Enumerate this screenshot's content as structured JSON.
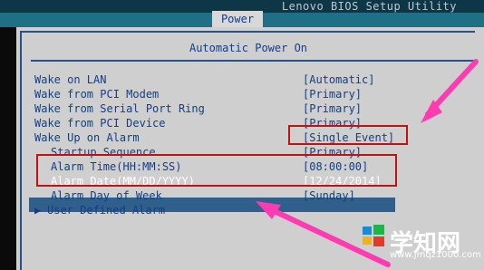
{
  "app": {
    "vendor_title": "Lenovo BIOS Setup Utility"
  },
  "tabs": {
    "active": "Power"
  },
  "section": {
    "title": "Automatic Power On"
  },
  "settings": [
    {
      "label": "Wake on LAN",
      "value": "[Automatic]"
    },
    {
      "label": "Wake from PCI Modem",
      "value": "[Primary]"
    },
    {
      "label": "Wake from Serial Port Ring",
      "value": "[Primary]"
    },
    {
      "label": "Wake from PCI Device",
      "value": "[Primary]"
    },
    {
      "label": "Wake Up on Alarm",
      "value": "[Single Event]"
    },
    {
      "label": "Startup Sequence",
      "value": "[Primary]"
    },
    {
      "label": "Alarm Time(HH:MM:SS)",
      "value": "[08:00:00]"
    },
    {
      "label": "Alarm Date(MM/DD/YYYY)",
      "value": "[12/24/2014]"
    },
    {
      "label": "Alarm Day of Week",
      "value": "[Sunday]"
    },
    {
      "label": "User Defined Alarm",
      "value": ""
    }
  ],
  "watermark": {
    "brand": "学知网",
    "url": "www.jmqz1000.com"
  },
  "colors": {
    "blue_text": "#123e8a",
    "panel_bg": "#cfcfcf",
    "topbar_bg": "#1f6f86",
    "highlight": "#2f5f8a",
    "annotation_red": "#c01212",
    "arrow_pink": "#ff3bb1"
  }
}
